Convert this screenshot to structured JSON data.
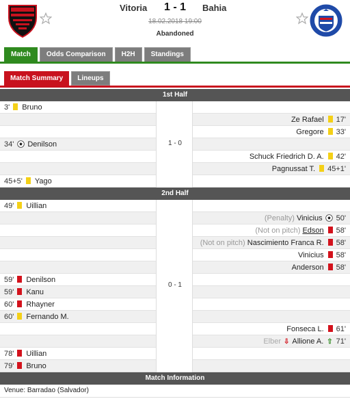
{
  "header": {
    "home_team": "Vitoria",
    "away_team": "Bahia",
    "score": "1 - 1",
    "datetime": "18.02.2018 19:00",
    "status": "Abandoned"
  },
  "tabs": [
    "Match",
    "Odds Comparison",
    "H2H",
    "Standings"
  ],
  "subtabs": [
    "Match Summary",
    "Lineups"
  ],
  "sections": {
    "first_half": "1st Half",
    "second_half": "2nd Half",
    "match_info": "Match Information"
  },
  "first_half_score": "1 - 0",
  "second_half_score": "0 - 1",
  "first_half_events": [
    {
      "side": "home",
      "minute": "3'",
      "type": "yellow",
      "player": "Bruno",
      "note": ""
    },
    {
      "side": "away",
      "minute": "17'",
      "type": "yellow",
      "player": "Ze Rafael",
      "note": ""
    },
    {
      "side": "away",
      "minute": "33'",
      "type": "yellow",
      "player": "Gregore",
      "note": ""
    },
    {
      "side": "home",
      "minute": "34'",
      "type": "goal",
      "player": "Denilson",
      "note": ""
    },
    {
      "side": "away",
      "minute": "42'",
      "type": "yellow",
      "player": "Schuck Friedrich D. A.",
      "note": ""
    },
    {
      "side": "away",
      "minute": "45+1'",
      "type": "yellow",
      "player": "Pagnussat T.",
      "note": ""
    },
    {
      "side": "home",
      "minute": "45+5'",
      "type": "yellow",
      "player": "Yago",
      "note": ""
    }
  ],
  "second_half_events": [
    {
      "side": "home",
      "minute": "49'",
      "type": "yellow",
      "player": "Uillian",
      "note": ""
    },
    {
      "side": "away",
      "minute": "50'",
      "type": "goal",
      "player": "Vinicius",
      "note": "(Penalty)"
    },
    {
      "side": "away",
      "minute": "58'",
      "type": "red",
      "player": "Edson",
      "note": "(Not on pitch)"
    },
    {
      "side": "away",
      "minute": "58'",
      "type": "red",
      "player": "Nascimiento Franca R.",
      "note": "(Not on pitch)"
    },
    {
      "side": "away",
      "minute": "58'",
      "type": "red",
      "player": "Vinicius",
      "note": ""
    },
    {
      "side": "away",
      "minute": "58'",
      "type": "red",
      "player": "Anderson",
      "note": ""
    },
    {
      "side": "home",
      "minute": "59'",
      "type": "red",
      "player": "Denilson",
      "note": ""
    },
    {
      "side": "home",
      "minute": "59'",
      "type": "red",
      "player": "Kanu",
      "note": ""
    },
    {
      "side": "home",
      "minute": "60'",
      "type": "red",
      "player": "Rhayner",
      "note": ""
    },
    {
      "side": "home",
      "minute": "60'",
      "type": "yellow",
      "player": "Fernando M.",
      "note": ""
    },
    {
      "side": "away",
      "minute": "61'",
      "type": "red",
      "player": "Fonseca L.",
      "note": ""
    },
    {
      "side": "away",
      "minute": "71'",
      "type": "sub",
      "player": "Allione A.",
      "note": "Elber"
    },
    {
      "side": "home",
      "minute": "78'",
      "type": "red",
      "player": "Uillian",
      "note": ""
    },
    {
      "side": "home",
      "minute": "79'",
      "type": "red",
      "player": "Bruno",
      "note": ""
    }
  ],
  "venue": "Venue: Barradao (Salvador)",
  "icons": {
    "star": "star-outline-icon",
    "yellow_card": "yellow-card-icon",
    "red_card": "red-card-icon",
    "goal": "soccer-ball-icon",
    "sub_out": "arrow-down-icon",
    "sub_in": "arrow-up-icon"
  },
  "colors": {
    "green": "#2f8a1f",
    "red": "#c8121e",
    "yellow_card": "#f4d017",
    "red_card": "#d3121c"
  }
}
